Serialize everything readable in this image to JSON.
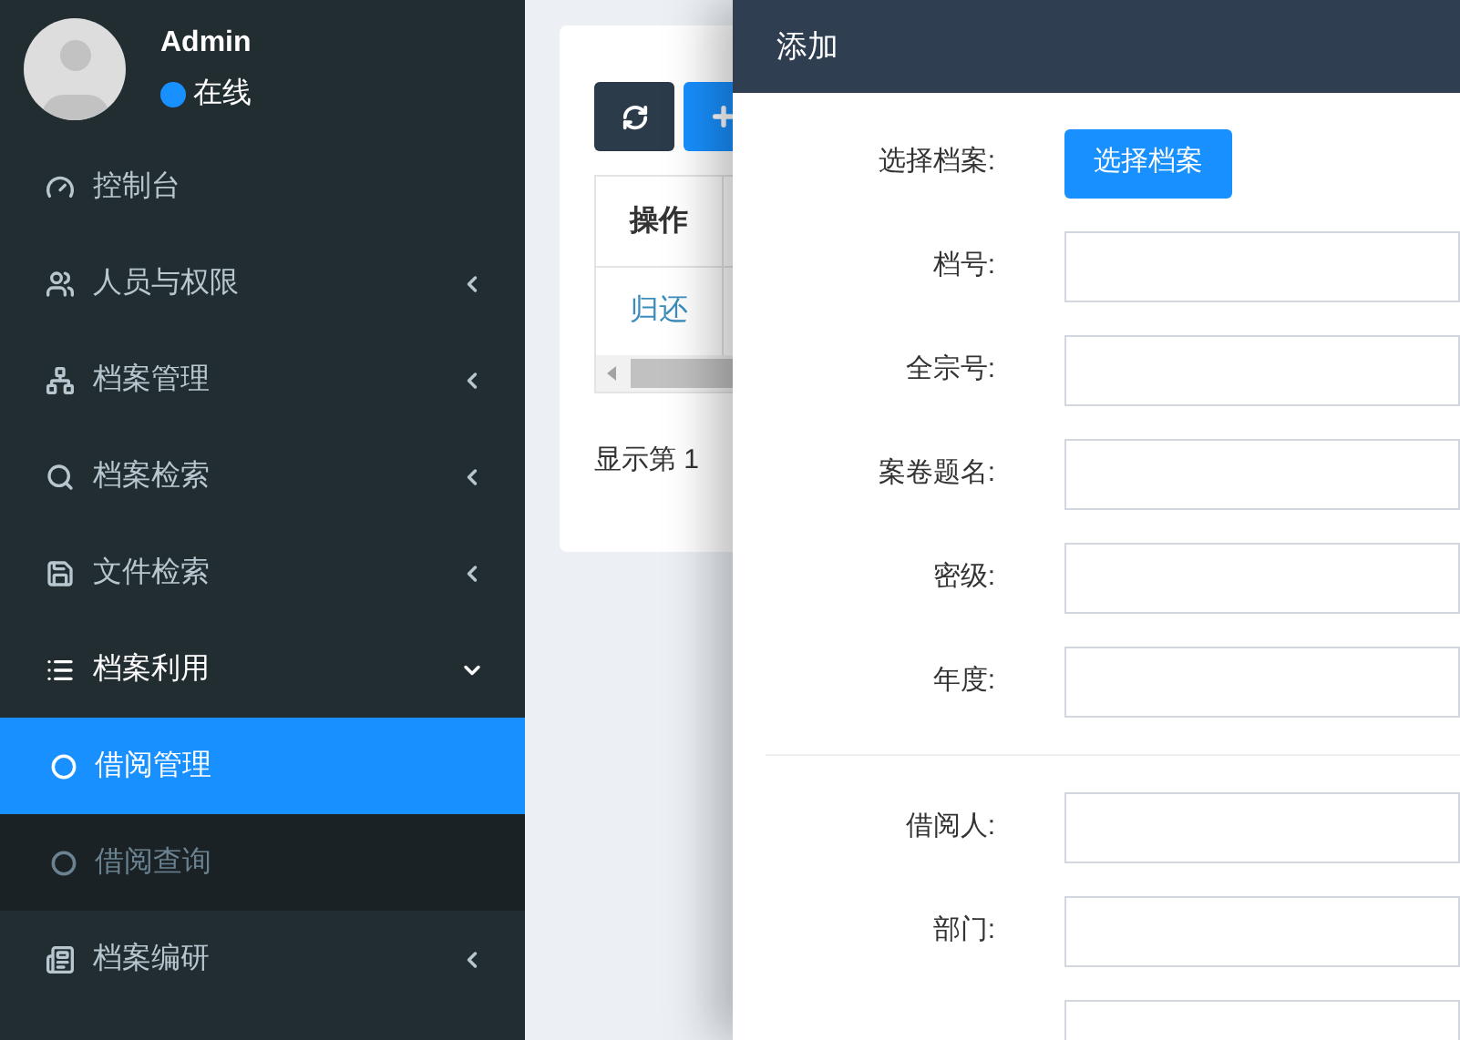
{
  "user": {
    "name": "Admin",
    "status": "在线"
  },
  "sidebar": {
    "items": [
      {
        "label": "控制台"
      },
      {
        "label": "人员与权限",
        "expanded": false
      },
      {
        "label": "档案管理",
        "expanded": false
      },
      {
        "label": "档案检索",
        "expanded": false
      },
      {
        "label": "文件检索",
        "expanded": false
      },
      {
        "label": "档案利用",
        "expanded": true,
        "children": [
          {
            "label": "借阅管理",
            "selected": true
          },
          {
            "label": "借阅查询",
            "selected": false
          }
        ]
      },
      {
        "label": "档案编研",
        "expanded": false
      }
    ]
  },
  "table": {
    "columns": [
      "操作"
    ],
    "rows": [
      [
        "归还"
      ]
    ]
  },
  "pagination": "显示第 1",
  "drawer": {
    "title": "添加",
    "fields": [
      {
        "kind": "button",
        "label": "选择档案:",
        "button": "选择档案"
      },
      {
        "kind": "input",
        "label": "档号:"
      },
      {
        "kind": "input",
        "label": "全宗号:"
      },
      {
        "kind": "input",
        "label": "案卷题名:"
      },
      {
        "kind": "input",
        "label": "密级:"
      },
      {
        "kind": "input",
        "label": "年度:"
      },
      {
        "kind": "divider"
      },
      {
        "kind": "input",
        "label": "借阅人:"
      },
      {
        "kind": "input",
        "label": "部门:"
      },
      {
        "kind": "input"
      }
    ]
  }
}
